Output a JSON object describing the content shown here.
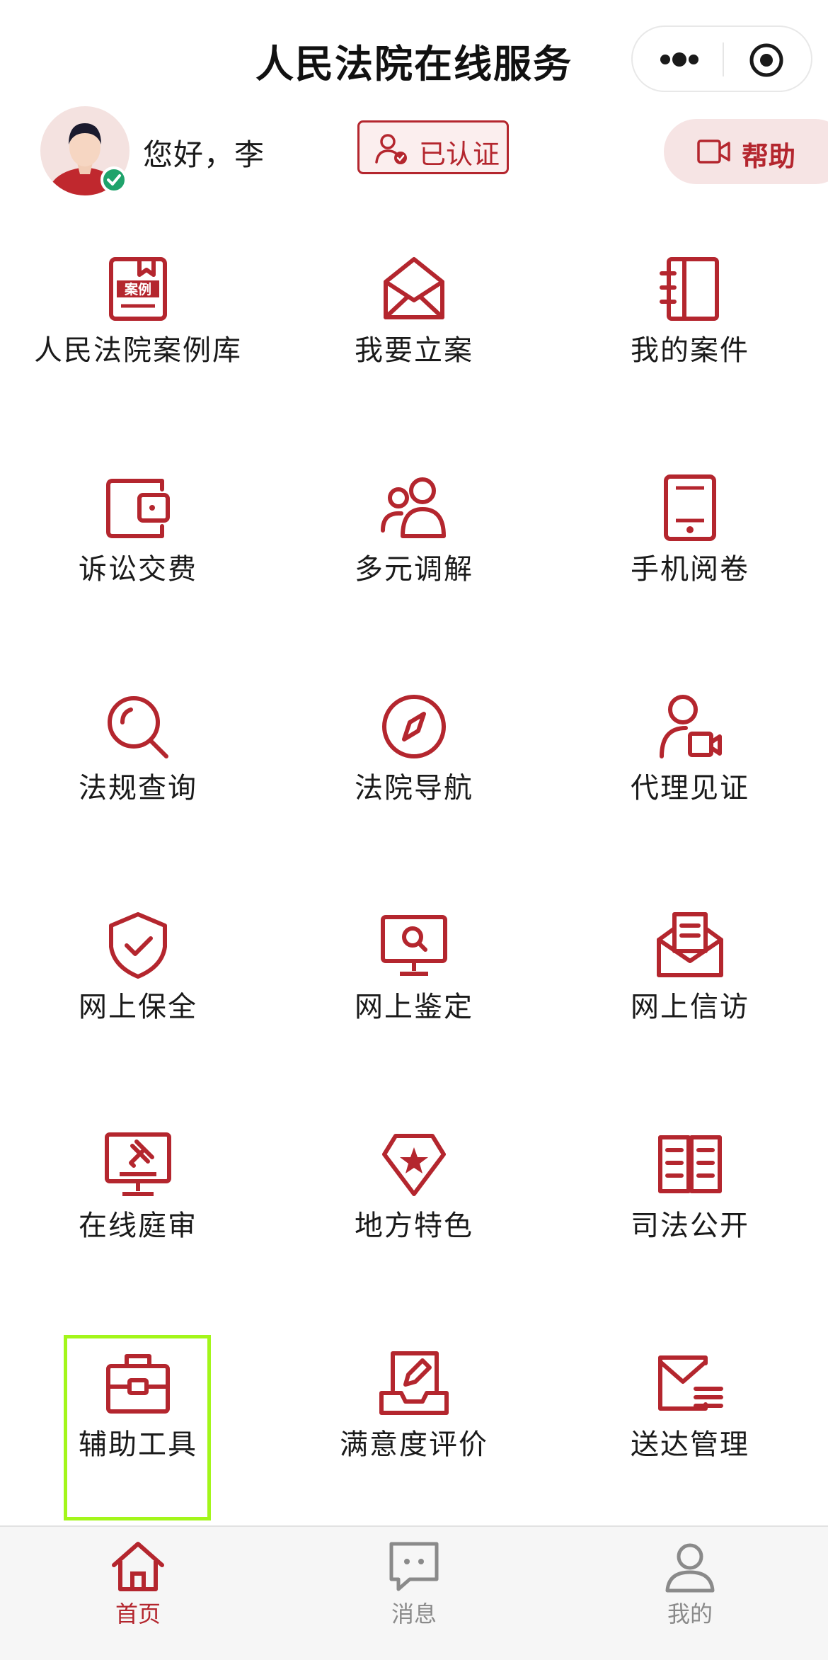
{
  "header": {
    "title": "人民法院在线服务",
    "more_icon": "more-dots-icon",
    "close_icon": "target-icon"
  },
  "user": {
    "greeting": "您好，李",
    "verified_label": "已认证",
    "help_label": "帮助"
  },
  "colors": {
    "accent": "#b4262e",
    "accent_light": "#f6e4e4",
    "highlight": "#a3f61a",
    "inactive": "#8a8a8a"
  },
  "services": [
    {
      "label": "人民法院案例库",
      "icon": "case-library-icon",
      "badge": "案例"
    },
    {
      "label": "我要立案",
      "icon": "envelope-open-icon"
    },
    {
      "label": "我的案件",
      "icon": "notebook-icon"
    },
    {
      "label": "诉讼交费",
      "icon": "wallet-icon"
    },
    {
      "label": "多元调解",
      "icon": "people-icon"
    },
    {
      "label": "手机阅卷",
      "icon": "tablet-icon"
    },
    {
      "label": "法规查询",
      "icon": "search-icon"
    },
    {
      "label": "法院导航",
      "icon": "compass-icon"
    },
    {
      "label": "代理见证",
      "icon": "person-video-icon"
    },
    {
      "label": "网上保全",
      "icon": "shield-check-icon"
    },
    {
      "label": "网上鉴定",
      "icon": "monitor-search-icon"
    },
    {
      "label": "网上信访",
      "icon": "letter-icon"
    },
    {
      "label": "在线庭审",
      "icon": "gavel-monitor-icon"
    },
    {
      "label": "地方特色",
      "icon": "star-badge-icon"
    },
    {
      "label": "司法公开",
      "icon": "open-book-icon"
    },
    {
      "label": "辅助工具",
      "icon": "toolbox-icon"
    },
    {
      "label": "满意度评价",
      "icon": "pencil-tray-icon"
    },
    {
      "label": "送达管理",
      "icon": "mail-list-icon"
    }
  ],
  "tabs": [
    {
      "label": "首页",
      "icon": "home-icon",
      "active": true
    },
    {
      "label": "消息",
      "icon": "chat-icon",
      "active": false
    },
    {
      "label": "我的",
      "icon": "user-icon",
      "active": false
    }
  ]
}
